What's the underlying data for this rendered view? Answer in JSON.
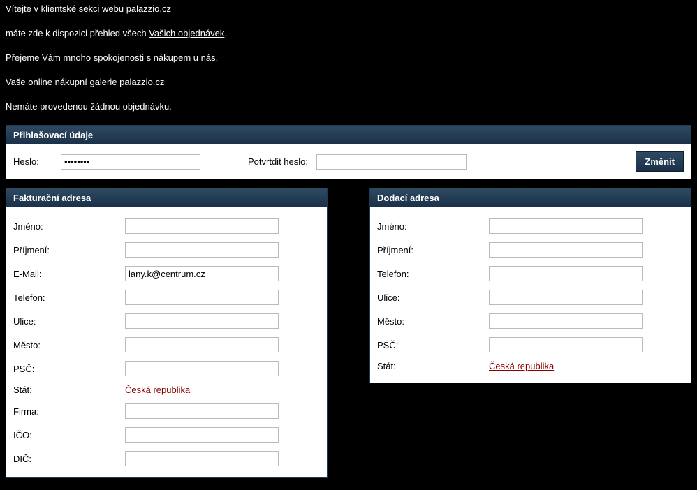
{
  "intro": {
    "line1_pre": "Vítejte v klientské sekci webu palazzio.cz",
    "line2_pre": "máte zde k dispozici přehled všech ",
    "line2_link": "Vašich objednávek",
    "line2_post": ".",
    "line3": "Přejeme Vám mnoho spokojenosti s nákupem u nás,",
    "line4": "Vaše online nákupní galerie palazzio.cz",
    "line5": "Nemáte provedenou žádnou objednávku."
  },
  "login": {
    "header": "Přihlašovací údaje",
    "password_label": "Heslo:",
    "password_value": "••••••••",
    "confirm_label": "Potvrtdit heslo:",
    "confirm_value": "",
    "button": "Změnit"
  },
  "billing": {
    "header": "Fakturační adresa",
    "fields": {
      "jmeno_label": "Jméno:",
      "jmeno": "",
      "prijmeni_label": "Příjmení:",
      "prijmeni": "",
      "email_label": "E-Mail:",
      "email": "lany.k@centrum.cz",
      "telefon_label": "Telefon:",
      "telefon": "",
      "ulice_label": "Ulice:",
      "ulice": "",
      "mesto_label": "Město:",
      "mesto": "",
      "psc_label": "PSČ:",
      "psc": "",
      "stat_label": "Stát:",
      "stat": "Česká republika",
      "firma_label": "Firma:",
      "firma": "",
      "ico_label": "IČO:",
      "ico": "",
      "dic_label": "DIČ:",
      "dic": ""
    }
  },
  "shipping": {
    "header": "Dodací adresa",
    "fields": {
      "jmeno_label": "Jméno:",
      "jmeno": "",
      "prijmeni_label": "Příjmení:",
      "prijmeni": "",
      "telefon_label": "Telefon:",
      "telefon": "",
      "ulice_label": "Ulice:",
      "ulice": "",
      "mesto_label": "Město:",
      "mesto": "",
      "psc_label": "PSČ:",
      "psc": "",
      "stat_label": "Stát:",
      "stat": "Česká republika"
    }
  }
}
